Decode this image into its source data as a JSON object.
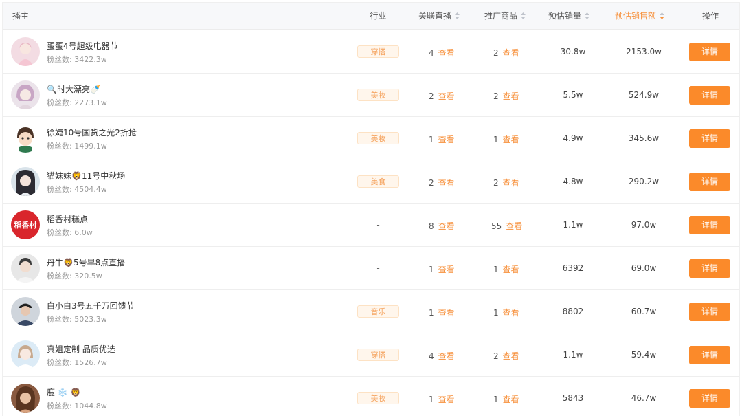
{
  "header": {
    "host": "播主",
    "industry": "行业",
    "related_live": "关联直播",
    "products": "推广商品",
    "est_volume": "预估销量",
    "est_sales": "预估销售额",
    "action": "操作"
  },
  "colors": {
    "accent": "#fb8a2a",
    "tag_text": "#f5a25d",
    "tag_bg": "#fff6ec",
    "link": "#f7913c"
  },
  "rows": [
    {
      "name": "蛋蛋4号超级电器节",
      "fans": "粉丝数: 3422.3w",
      "industry": "穿搭",
      "live_count": "4",
      "live_view": "查看",
      "product_count": "2",
      "product_view": "查看",
      "volume": "30.8w",
      "sales": "2153.0w",
      "detail": "详情",
      "avatar": "avatar-pink-icon"
    },
    {
      "name": "🔍时大漂亮🍼",
      "fans": "粉丝数: 2273.1w",
      "industry": "美妆",
      "live_count": "2",
      "live_view": "查看",
      "product_count": "2",
      "product_view": "查看",
      "volume": "5.5w",
      "sales": "524.9w",
      "detail": "详情",
      "avatar": "avatar-purple-icon"
    },
    {
      "name": "徐婕10号国货之光2折抢",
      "fans": "粉丝数: 1499.1w",
      "industry": "美妆",
      "live_count": "1",
      "live_view": "查看",
      "product_count": "1",
      "product_view": "查看",
      "volume": "4.9w",
      "sales": "345.6w",
      "detail": "详情",
      "avatar": "avatar-cartoon-icon"
    },
    {
      "name": "猫妹妹🦁11号中秋场",
      "fans": "粉丝数: 4504.4w",
      "industry": "美食",
      "live_count": "2",
      "live_view": "查看",
      "product_count": "2",
      "product_view": "查看",
      "volume": "4.8w",
      "sales": "290.2w",
      "detail": "详情",
      "avatar": "avatar-dark-hair-icon"
    },
    {
      "name": "稻香村糕点",
      "fans": "粉丝数: 6.0w",
      "industry": "-",
      "live_count": "8",
      "live_view": "查看",
      "product_count": "55",
      "product_view": "查看",
      "volume": "1.1w",
      "sales": "97.0w",
      "detail": "详情",
      "avatar": "avatar-brand-logo-icon",
      "logo_text": "稻香村"
    },
    {
      "name": "丹牛🦁5号早8点直播",
      "fans": "粉丝数: 320.5w",
      "industry": "-",
      "live_count": "1",
      "live_view": "查看",
      "product_count": "1",
      "product_view": "查看",
      "volume": "6392",
      "sales": "69.0w",
      "detail": "详情",
      "avatar": "avatar-man-icon"
    },
    {
      "name": "白小白3号五千万回馈节",
      "fans": "粉丝数: 5023.3w",
      "industry": "音乐",
      "live_count": "1",
      "live_view": "查看",
      "product_count": "1",
      "product_view": "查看",
      "volume": "8802",
      "sales": "60.7w",
      "detail": "详情",
      "avatar": "avatar-man-cap-icon"
    },
    {
      "name": "真姐定制 品质优选",
      "fans": "粉丝数: 1526.7w",
      "industry": "穿搭",
      "live_count": "4",
      "live_view": "查看",
      "product_count": "2",
      "product_view": "查看",
      "volume": "1.1w",
      "sales": "59.4w",
      "detail": "详情",
      "avatar": "avatar-blue-icon"
    },
    {
      "name": "鹿 ❄️ 🦁",
      "fans": "粉丝数: 1044.8w",
      "industry": "美妆",
      "live_count": "1",
      "live_view": "查看",
      "product_count": "1",
      "product_view": "查看",
      "volume": "5843",
      "sales": "46.7w",
      "detail": "详情",
      "avatar": "avatar-brown-hair-icon"
    }
  ]
}
